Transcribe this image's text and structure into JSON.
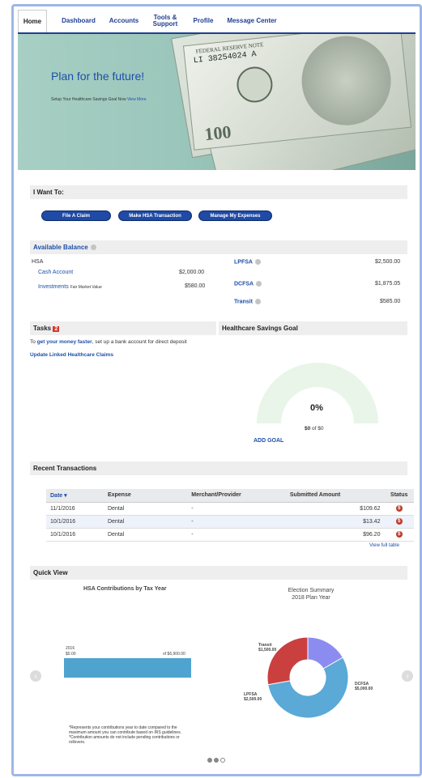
{
  "nav": {
    "tabs": [
      {
        "label": "Home"
      },
      {
        "label": "Dashboard"
      },
      {
        "label": "Accounts"
      },
      {
        "label": "Tools &\nSupport"
      },
      {
        "label": "Profile"
      },
      {
        "label": "Message Center"
      }
    ]
  },
  "hero": {
    "title": "Plan for the future!",
    "subtitle": "Setup Your Healthcare Savings Goal Now",
    "subtitle_link": "View More",
    "bill_text": "FEDERAL RESERVE NOTE",
    "bill_serial": "LI 38254024 A",
    "bill_denom": "100"
  },
  "i_want_to": {
    "heading": "I Want To:",
    "buttons": [
      "File A Claim",
      "Make HSA Transaction",
      "Manage My Expenses"
    ]
  },
  "balance": {
    "heading": "Available Balance",
    "hsa_label": "HSA",
    "cash_label": "Cash Account",
    "cash_value": "$2,000.00",
    "investments_label": "Investments",
    "fmv_label": "Fair Market Value",
    "investments_value": "$580.00",
    "lpfsa_label": "LPFSA",
    "lpfsa_value": "$2,500.00",
    "dcfsa_label": "DCFSA",
    "dcfsa_value": "$1,875.05",
    "transit_label": "Transit",
    "transit_value": "$585.00"
  },
  "tasks": {
    "heading": "Tasks",
    "badge": "2",
    "line1_pre": "To",
    "line1_link": "get your money faster",
    "line1_post": ", set up a bank account for direct deposit",
    "line2": "Update Linked Healthcare Claims"
  },
  "goal": {
    "heading": "Healthcare Savings Goal",
    "percent": "0%",
    "amount": "$0",
    "of_text": "of $0",
    "add_goal": "ADD GOAL",
    "fraction": 0
  },
  "transactions": {
    "heading": "Recent Transactions",
    "columns": [
      "Date",
      "Expense",
      "Merchant/Provider",
      "Submitted Amount",
      "Status"
    ],
    "rows": [
      {
        "date": "11/1/2016",
        "expense": "Dental",
        "merchant": "-",
        "amount": "$109.62"
      },
      {
        "date": "10/1/2016",
        "expense": "Dental",
        "merchant": "-",
        "amount": "$13.42"
      },
      {
        "date": "10/1/2016",
        "expense": "Dental",
        "merchant": "-",
        "amount": "$96.20"
      }
    ],
    "status_glyph": "$",
    "view_full": "View full table"
  },
  "quick_view": {
    "heading": "Quick View",
    "hsa_chart_title": "HSA Contributions by Tax Year",
    "hsa_year": "2016",
    "hsa_contributed": "$0.00",
    "hsa_max": "of $6,900.00",
    "election_title": "Election Summary",
    "election_sub": "2018 Plan Year",
    "footnote": "*Represents your contributions year to date compared to the maximum amount you can contribute based on IRS guidelines.\n*Contribution amounts do not include pending contributions or rollovers."
  },
  "chart_data": {
    "type": "pie",
    "title": "Election Summary",
    "subtitle": "2018 Plan Year",
    "slices": [
      {
        "label": "DCFSA",
        "amount": "$5,000.00",
        "value": 5000,
        "color": "#5aa9d6"
      },
      {
        "label": "LPFSA",
        "amount": "$2,500.00",
        "value": 2500,
        "color": "#c9403f"
      },
      {
        "label": "Transit",
        "amount": "$1,500.00",
        "value": 1500,
        "color": "#8c8cf0"
      }
    ]
  }
}
